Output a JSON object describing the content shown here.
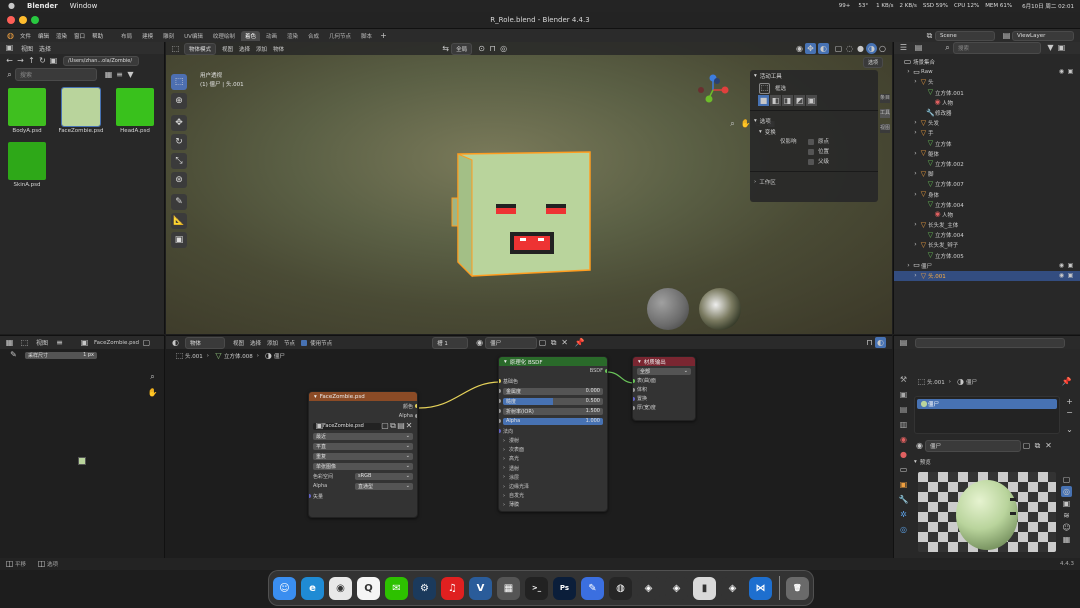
{
  "menubar": {
    "app": "Blender",
    "menu": [
      "Window"
    ],
    "status": [
      "99+",
      "53°",
      "1 KB/s",
      "2 KB/s",
      "SSD 59%",
      "CPU 12%",
      "MEM 61%"
    ],
    "datetime": "6月10日 周二  02:01"
  },
  "window": {
    "title": "R_Role.blend - Blender 4.4.3"
  },
  "topbar": {
    "menus": [
      "文件",
      "编辑",
      "渲染",
      "窗口",
      "帮助"
    ],
    "workspaces": [
      "布局",
      "建模",
      "雕刻",
      "UV编辑",
      "纹理绘制",
      "着色",
      "动画",
      "渲染",
      "合成",
      "几何节点",
      "脚本"
    ],
    "active_workspace": "着色",
    "scene_name": "Scene",
    "view_layer": "ViewLayer"
  },
  "filebrowser": {
    "menus": [
      "视图",
      "选择"
    ],
    "path": "/Users/zhan...ola/Zombie/",
    "search_placeholder": "搜索",
    "files": [
      {
        "name": "BodyA.psd",
        "color": "#3fbf1f"
      },
      {
        "name": "FaceZombie.psd",
        "color": "#b9d49c"
      },
      {
        "name": "HeadA.psd",
        "color": "#39c11c"
      },
      {
        "name": "SkinA.psd",
        "color": "#2ea818"
      }
    ]
  },
  "viewport": {
    "mode": "物体模式",
    "menus": [
      "视图",
      "选择",
      "添加",
      "物体"
    ],
    "transform": "全局",
    "view_label": "用户透视",
    "collection_label": "(1) 僵尸 | 头.001",
    "options_label": "选项"
  },
  "npanel": {
    "active_tool_title": "活动工具",
    "tool_name": "框选",
    "options_title": "选项",
    "transform_title": "变换",
    "affect_only_label": "仅影响",
    "checkboxes": [
      "原点",
      "位置",
      "父级"
    ],
    "workspace_title": "工作区",
    "tabs": [
      "条目",
      "工具",
      "视图"
    ]
  },
  "outliner": {
    "search_placeholder": "搜索",
    "scene_collection": "场景集合",
    "rows": [
      {
        "indent": 1,
        "label": "Raw",
        "type": "collection"
      },
      {
        "indent": 2,
        "label": "头",
        "type": "object"
      },
      {
        "indent": 3,
        "label": "立方体.001",
        "type": "mesh"
      },
      {
        "indent": 4,
        "label": "人物",
        "type": "material"
      },
      {
        "indent": 3,
        "label": "修改器",
        "type": "modifier"
      },
      {
        "indent": 2,
        "label": "头发",
        "type": "object"
      },
      {
        "indent": 2,
        "label": "手",
        "type": "object"
      },
      {
        "indent": 3,
        "label": "立方体",
        "type": "mesh"
      },
      {
        "indent": 2,
        "label": "躯体",
        "type": "object"
      },
      {
        "indent": 3,
        "label": "立方体.002",
        "type": "mesh"
      },
      {
        "indent": 2,
        "label": "脚",
        "type": "object"
      },
      {
        "indent": 3,
        "label": "立方体.007",
        "type": "mesh"
      },
      {
        "indent": 2,
        "label": "身体",
        "type": "object"
      },
      {
        "indent": 3,
        "label": "立方体.004",
        "type": "mesh"
      },
      {
        "indent": 4,
        "label": "人物",
        "type": "material"
      },
      {
        "indent": 2,
        "label": "长头发_主体",
        "type": "object"
      },
      {
        "indent": 3,
        "label": "立方体.004",
        "type": "mesh"
      },
      {
        "indent": 2,
        "label": "长头发_辫子",
        "type": "object"
      },
      {
        "indent": 3,
        "label": "立方体.005",
        "type": "mesh"
      },
      {
        "indent": 1,
        "label": "僵尸",
        "type": "collection"
      },
      {
        "indent": 2,
        "label": "头.001",
        "type": "object",
        "selected": true
      }
    ]
  },
  "imgeditor": {
    "menus": [
      "视图"
    ],
    "image_name": "FaceZombie.psd",
    "sample_label": "采样尺寸",
    "sample_value": "1 px"
  },
  "nodeeditor": {
    "menus": [
      "物体",
      "视图",
      "选择",
      "添加",
      "节点"
    ],
    "use_nodes_label": "使用节点",
    "slot": "槽 1",
    "material": "僵尸",
    "breadcrumb": [
      "头.001",
      "立方体.008",
      "僵尸"
    ],
    "image_node": {
      "title": "FaceZombie.psd",
      "outputs": [
        "颜色",
        "Alpha"
      ],
      "image": "FaceZombie.psd",
      "rows": [
        "最近",
        "平直",
        "重复",
        "单张图像"
      ],
      "colorspace_label": "色彩空间",
      "colorspace_value": "sRGB",
      "alpha_label": "Alpha",
      "alpha_value": "直通型",
      "vector_label": "矢量"
    },
    "bsdf_node": {
      "title": "原理化 BSDF",
      "output": "BSDF",
      "base_color": "基础色",
      "fields": [
        {
          "label": "金属度",
          "value": "0.000",
          "fill": 0.0
        },
        {
          "label": "糙度",
          "value": "0.500",
          "fill": 0.5
        },
        {
          "label": "折射率(IOR)",
          "value": "1.500",
          "fill": 0.0
        },
        {
          "label": "Alpha",
          "value": "1.000",
          "fill": 1.0
        }
      ],
      "normal": "法向",
      "sections": [
        "漫射",
        "次表面",
        "高光",
        "透射",
        "涂层",
        "边缘光泽",
        "自发光",
        "薄膜"
      ]
    },
    "output_node": {
      "title": "材质输出",
      "target": "全部",
      "inputs": [
        "表(曲)面",
        "体积",
        "置换",
        "厚(宽)度"
      ]
    }
  },
  "props": {
    "breadcrumb": [
      "头.001",
      "僵尸"
    ],
    "material_slot": "僵尸",
    "material_field": "僵尸",
    "preview_title": "预览"
  },
  "statusbar": {
    "left": [
      "平移",
      "选项"
    ],
    "version": "4.4.3"
  },
  "dock": [
    {
      "name": "finder",
      "color": "#3a8ef0",
      "glyph": "☺"
    },
    {
      "name": "edge",
      "color": "#1f8bd4",
      "glyph": "e"
    },
    {
      "name": "chrome",
      "color": "#e8e8e8",
      "glyph": "◉"
    },
    {
      "name": "qq",
      "color": "#f5f5f5",
      "glyph": "Q"
    },
    {
      "name": "wechat",
      "color": "#2dc100",
      "glyph": "✉"
    },
    {
      "name": "steam",
      "color": "#1b3a5c",
      "glyph": "⚙"
    },
    {
      "name": "netease-music",
      "color": "#e02020",
      "glyph": "♫"
    },
    {
      "name": "vscode-alt",
      "color": "#2a5c9a",
      "glyph": "V"
    },
    {
      "name": "calculator",
      "color": "#555555",
      "glyph": "▦"
    },
    {
      "name": "terminal",
      "color": "#222222",
      "glyph": ">_"
    },
    {
      "name": "photoshop",
      "color": "#0b1e3a",
      "glyph": "Ps"
    },
    {
      "name": "pen-app",
      "color": "#3b6fe0",
      "glyph": "✎"
    },
    {
      "name": "blender",
      "color": "#262626",
      "glyph": "◍"
    },
    {
      "name": "unity-1",
      "color": "#333333",
      "glyph": "◈"
    },
    {
      "name": "unity-2",
      "color": "#333333",
      "glyph": "◈"
    },
    {
      "name": "notes",
      "color": "#d9d9d9",
      "glyph": "▮"
    },
    {
      "name": "unity-3",
      "color": "#333333",
      "glyph": "◈"
    },
    {
      "name": "vscode",
      "color": "#1e6fcf",
      "glyph": "⋈"
    },
    {
      "name": "trash",
      "color": "#6a6a6a",
      "glyph": "🗑"
    }
  ],
  "colors": {
    "accent": "#4772b3",
    "image_node_header": "#8b4b26",
    "bsdf_header": "#2a6a2a",
    "output_header": "#7a2631",
    "selection_orange": "#ff9d1f",
    "head_cube": "#b9d49c"
  }
}
